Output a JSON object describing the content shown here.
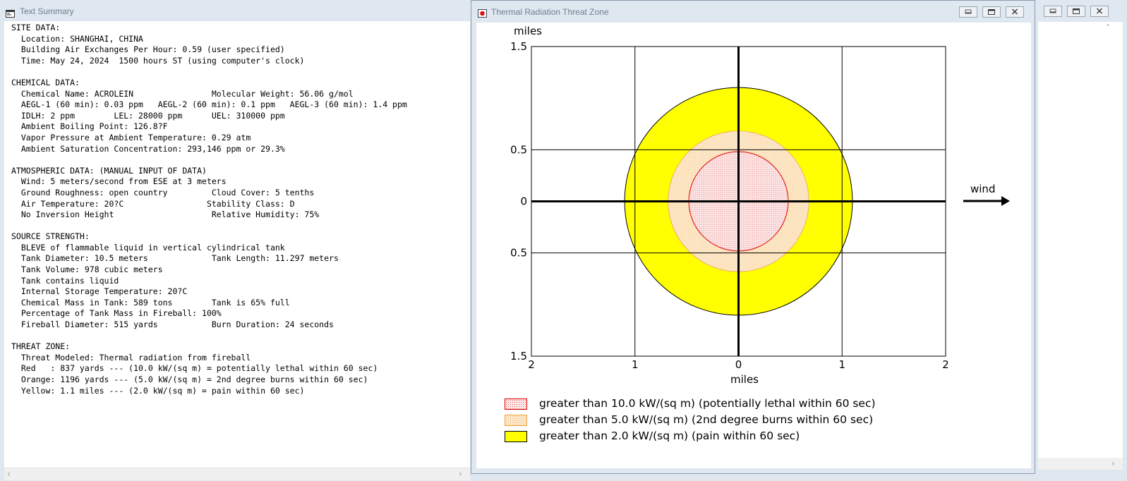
{
  "text_summary": {
    "title": "Text Summary",
    "lines": [
      "SITE DATA:",
      "  Location: SHANGHAI, CHINA",
      "  Building Air Exchanges Per Hour: 0.59 (user specified)",
      "  Time: May 24, 2024  1500 hours ST (using computer's clock)",
      "",
      "CHEMICAL DATA:",
      "  Chemical Name: ACROLEIN                Molecular Weight: 56.06 g/mol",
      "  AEGL-1 (60 min): 0.03 ppm   AEGL-2 (60 min): 0.1 ppm   AEGL-3 (60 min): 1.4 ppm",
      "  IDLH: 2 ppm        LEL: 28000 ppm      UEL: 310000 ppm",
      "  Ambient Boiling Point: 126.8?F",
      "  Vapor Pressure at Ambient Temperature: 0.29 atm",
      "  Ambient Saturation Concentration: 293,146 ppm or 29.3%",
      "",
      "ATMOSPHERIC DATA: (MANUAL INPUT OF DATA)",
      "  Wind: 5 meters/second from ESE at 3 meters",
      "  Ground Roughness: open country         Cloud Cover: 5 tenths",
      "  Air Temperature: 20?C                 Stability Class: D",
      "  No Inversion Height                    Relative Humidity: 75%",
      "",
      "SOURCE STRENGTH:",
      "  BLEVE of flammable liquid in vertical cylindrical tank",
      "  Tank Diameter: 10.5 meters             Tank Length: 11.297 meters",
      "  Tank Volume: 978 cubic meters",
      "  Tank contains liquid",
      "  Internal Storage Temperature: 20?C",
      "  Chemical Mass in Tank: 589 tons        Tank is 65% full",
      "  Percentage of Tank Mass in Fireball: 100%",
      "  Fireball Diameter: 515 yards           Burn Duration: 24 seconds",
      "",
      "THREAT ZONE:",
      "  Threat Modeled: Thermal radiation from fireball",
      "  Red   : 837 yards --- (10.0 kW/(sq m) = potentially lethal within 60 sec)",
      "  Orange: 1196 yards --- (5.0 kW/(sq m) = 2nd degree burns within 60 sec)",
      "  Yellow: 1.1 miles --- (2.0 kW/(sq m) = pain within 60 sec)"
    ]
  },
  "threat_zone": {
    "title": "Thermal Radiation Threat Zone",
    "wind_label": "wind",
    "legend": [
      {
        "text": "greater than 10.0 kW/(sq m) (potentially lethal within 60 sec)",
        "color": "#ff0000"
      },
      {
        "text": "greater than 5.0 kW/(sq m) (2nd degree burns within 60 sec)",
        "color": "#ffa500"
      },
      {
        "text": "greater than 2.0 kW/(sq m) (pain within 60 sec)",
        "color": "#ffff00"
      }
    ]
  },
  "chart_data": {
    "type": "area",
    "ylabel": "miles",
    "xlabel": "miles",
    "xlim": [
      -2,
      2
    ],
    "ylim": [
      -1.5,
      1.5
    ],
    "x_ticks": [
      "2",
      "1",
      "0",
      "1",
      "2"
    ],
    "y_ticks": [
      "1.5",
      "0.5",
      "0",
      "0.5",
      "1.5"
    ],
    "grid": true,
    "series": [
      {
        "name": "greater than 2.0 kW/(sq m) (pain within 60 sec)",
        "shape": "circle",
        "center": [
          0,
          0
        ],
        "radius_miles": 1.1,
        "color": "#ffff00"
      },
      {
        "name": "greater than 5.0 kW/(sq m) (2nd degree burns within 60 sec)",
        "shape": "circle",
        "center": [
          0,
          0
        ],
        "radius_miles": 0.68,
        "color": "#ffa500"
      },
      {
        "name": "greater than 10.0 kW/(sq m) (potentially lethal within 60 sec)",
        "shape": "circle",
        "center": [
          0,
          0
        ],
        "radius_miles": 0.48,
        "color": "#ff0000"
      }
    ]
  }
}
